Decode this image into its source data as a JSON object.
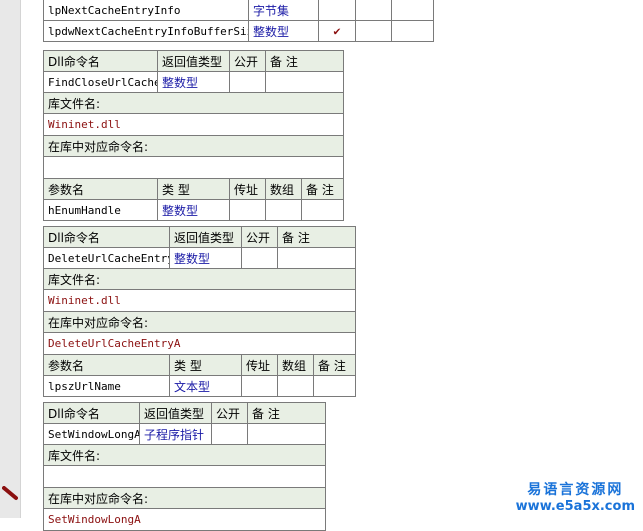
{
  "labels": {
    "dll_cmd": "Dll命令名",
    "ret_type": "返回值类型",
    "public": "公开",
    "remark": "备 注",
    "lib_file": "库文件名:",
    "lib_cmd": "在库中对应命令名:",
    "param_name": "参数名",
    "type": "类 型",
    "by_ref": "传址",
    "array": "数组"
  },
  "top_rows": [
    {
      "name": "lpNextCacheEntryInfo",
      "type": "字节集",
      "checked": ""
    },
    {
      "name": "lpdwNextCacheEntryInfoBufferSize",
      "type": "整数型",
      "checked": "✔"
    }
  ],
  "block1": {
    "cmd": "FindCloseUrlCache",
    "ret": "整数型",
    "lib": "Wininet.dll",
    "libcmd": "",
    "param": "hEnumHandle",
    "ptype": "整数型"
  },
  "block2": {
    "cmd": "DeleteUrlCacheEntry",
    "ret": "整数型",
    "lib": "Wininet.dll",
    "libcmd": "DeleteUrlCacheEntryA",
    "param": "lpszUrlName",
    "ptype": "文本型"
  },
  "block3": {
    "cmd": "SetWindowLongA",
    "ret": "子程序指针",
    "lib": "",
    "libcmd": "SetWindowLongA"
  },
  "watermark": {
    "title": "易语言资源网",
    "url": "www.e5a5x.com"
  }
}
